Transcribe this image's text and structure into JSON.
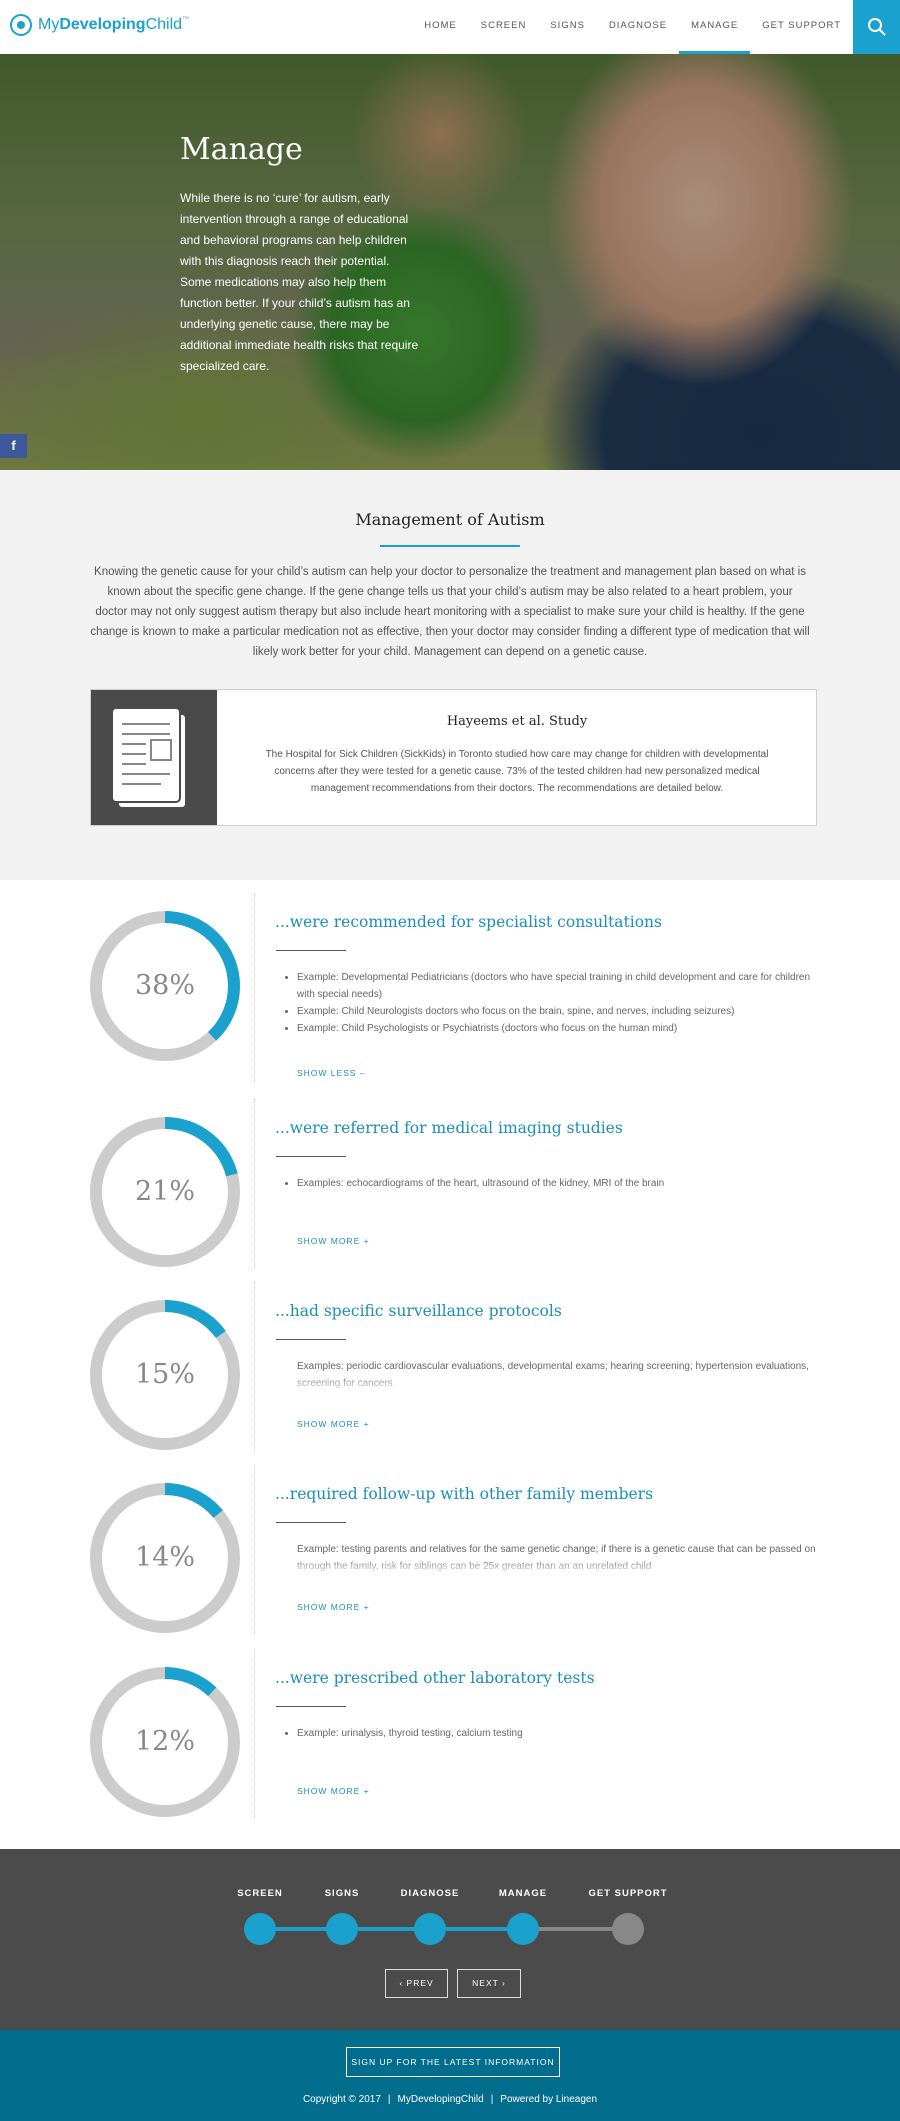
{
  "header": {
    "logo": {
      "pre": "My",
      "bold": "Developing",
      "post": "Child",
      "tm": "™"
    },
    "nav": [
      "HOME",
      "SCREEN",
      "SIGNS",
      "DIAGNOSE",
      "MANAGE",
      "GET SUPPORT"
    ],
    "active_nav": "MANAGE",
    "search_icon": "search-icon"
  },
  "hero": {
    "title": "Manage",
    "text": "While there is no ‘cure’ for autism, early intervention through a range of educational and behavioral programs can help children with this diagnosis reach their potential. Some medications may also help them function better. If your child’s autism has an underlying genetic cause, there may be additional immediate health risks that require specialized care.",
    "facebook_label": "f"
  },
  "management": {
    "title": "Management of Autism",
    "text": "Knowing the genetic cause for your child’s autism can help your doctor to personalize the treatment and management plan based on what is known about the specific gene change. If the gene change tells us that your child’s autism may be also related to a heart problem, your doctor may not only suggest autism therapy but also include heart monitoring with a specialist to make sure your child is healthy. If the gene change is known to make a particular medication not as effective, then your doctor may consider finding a different type of medication that will likely work better for your child. Management can depend on a genetic cause.",
    "study": {
      "title": "Hayeems et al. Study",
      "text": "The Hospital for Sick Children (SickKids) in Toronto studied how care may change for children with developmental concerns after they were tested for a genetic cause. 73% of the tested children had new personalized medical management recommendations from their doctors. The recommendations are detailed below.",
      "icon": "document-icon"
    }
  },
  "stats": [
    {
      "percent": 38,
      "label": "38%",
      "title": "...were recommended for specialist consultations",
      "items": [
        "Example: Developmental Pediatricians (doctors who have special training in child development and care for children with special needs)",
        "Example: Child Neurologists doctors who focus on the brain, spine, and nerves, including seizures)",
        "Example: Child Psychologists or Psychiatrists (doctors who focus on the human mind)"
      ],
      "toggle": "SHOW LESS –"
    },
    {
      "percent": 21,
      "label": "21%",
      "title": "...were referred for medical imaging studies",
      "items": [
        "Examples: echocardiograms of the heart, ultrasound of the kidney, MRI of the brain"
      ],
      "toggle": "SHOW MORE +"
    },
    {
      "percent": 15,
      "label": "15%",
      "title": "...had specific surveillance protocols",
      "items": [
        "Examples: periodic cardiovascular evaluations, developmental exams; hearing screening; hypertension evaluations, screening for cancers"
      ],
      "toggle": "SHOW MORE +"
    },
    {
      "percent": 14,
      "label": "14%",
      "title": "...required follow-up with other family members",
      "items": [
        "Example: testing parents and relatives for the same genetic change; if there is a genetic cause that can be passed on through the family, risk for siblings can be 25x greater than an an unrelated child"
      ],
      "toggle": "SHOW MORE +"
    },
    {
      "percent": 12,
      "label": "12%",
      "title": "...were prescribed other laboratory tests",
      "items": [
        "Example: urinalysis, thyroid testing, calcium testing"
      ],
      "toggle": "SHOW MORE +"
    }
  ],
  "colors": {
    "accent": "#1ba1cd",
    "ring_bg": "#cccccc",
    "inactive_step": "#888888",
    "footer": "#036d8e"
  },
  "steps": {
    "items": [
      "SCREEN",
      "SIGNS",
      "DIAGNOSE",
      "MANAGE",
      "GET SUPPORT"
    ],
    "completed_count": 4,
    "prev": "‹ PREV",
    "next": "NEXT ›"
  },
  "footer": {
    "signup": "SIGN UP FOR THE LATEST INFORMATION",
    "copyright": "Copyright © 2017",
    "site": "MyDevelopingChild",
    "powered": "Powered by Lineagen"
  }
}
